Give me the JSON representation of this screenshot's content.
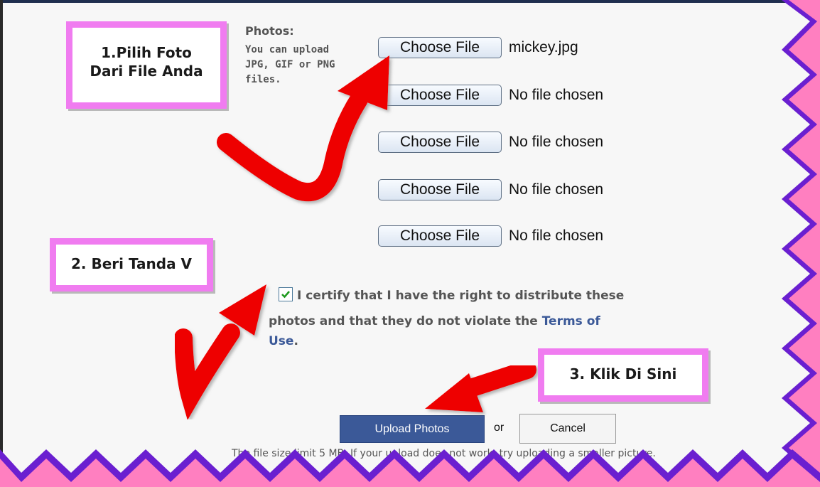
{
  "callouts": {
    "step1_line1": "1.Pilih Foto",
    "step1_line2": "Dari File Anda",
    "step2": "2. Beri Tanda V",
    "step3": "3. Klik Di Sini"
  },
  "photos": {
    "label": "Photos:",
    "help_lines": [
      "You can upload",
      "JPG, GIF or PNG",
      "files."
    ]
  },
  "file_inputs": [
    {
      "button": "Choose File",
      "filename": "mickey.jpg"
    },
    {
      "button": "Choose File",
      "filename": "No file chosen"
    },
    {
      "button": "Choose File",
      "filename": "No file chosen"
    },
    {
      "button": "Choose File",
      "filename": "No file chosen"
    },
    {
      "button": "Choose File",
      "filename": "No file chosen"
    }
  ],
  "certify": {
    "checked": true,
    "line1": "I certify that I have the right to distribute these",
    "line2": "photos and that they do not violate the",
    "terms_part1": "Terms of",
    "terms_part2": "Use",
    "period": "."
  },
  "actions": {
    "upload_label": "Upload Photos",
    "or_label": "or",
    "cancel_label": "Cancel"
  },
  "note": "The file size limit 5 MB. If your upload does not work, try uploading a smaller picture.",
  "colors": {
    "callout_border": "#f07cf0",
    "zigzag_pink": "#ff7fc0",
    "zigzag_purple": "#6a1fd0",
    "arrow_red": "#ee0000",
    "facebook_blue": "#3b5998"
  },
  "icons": [
    "red-arrow-icon",
    "checkmark-icon"
  ]
}
